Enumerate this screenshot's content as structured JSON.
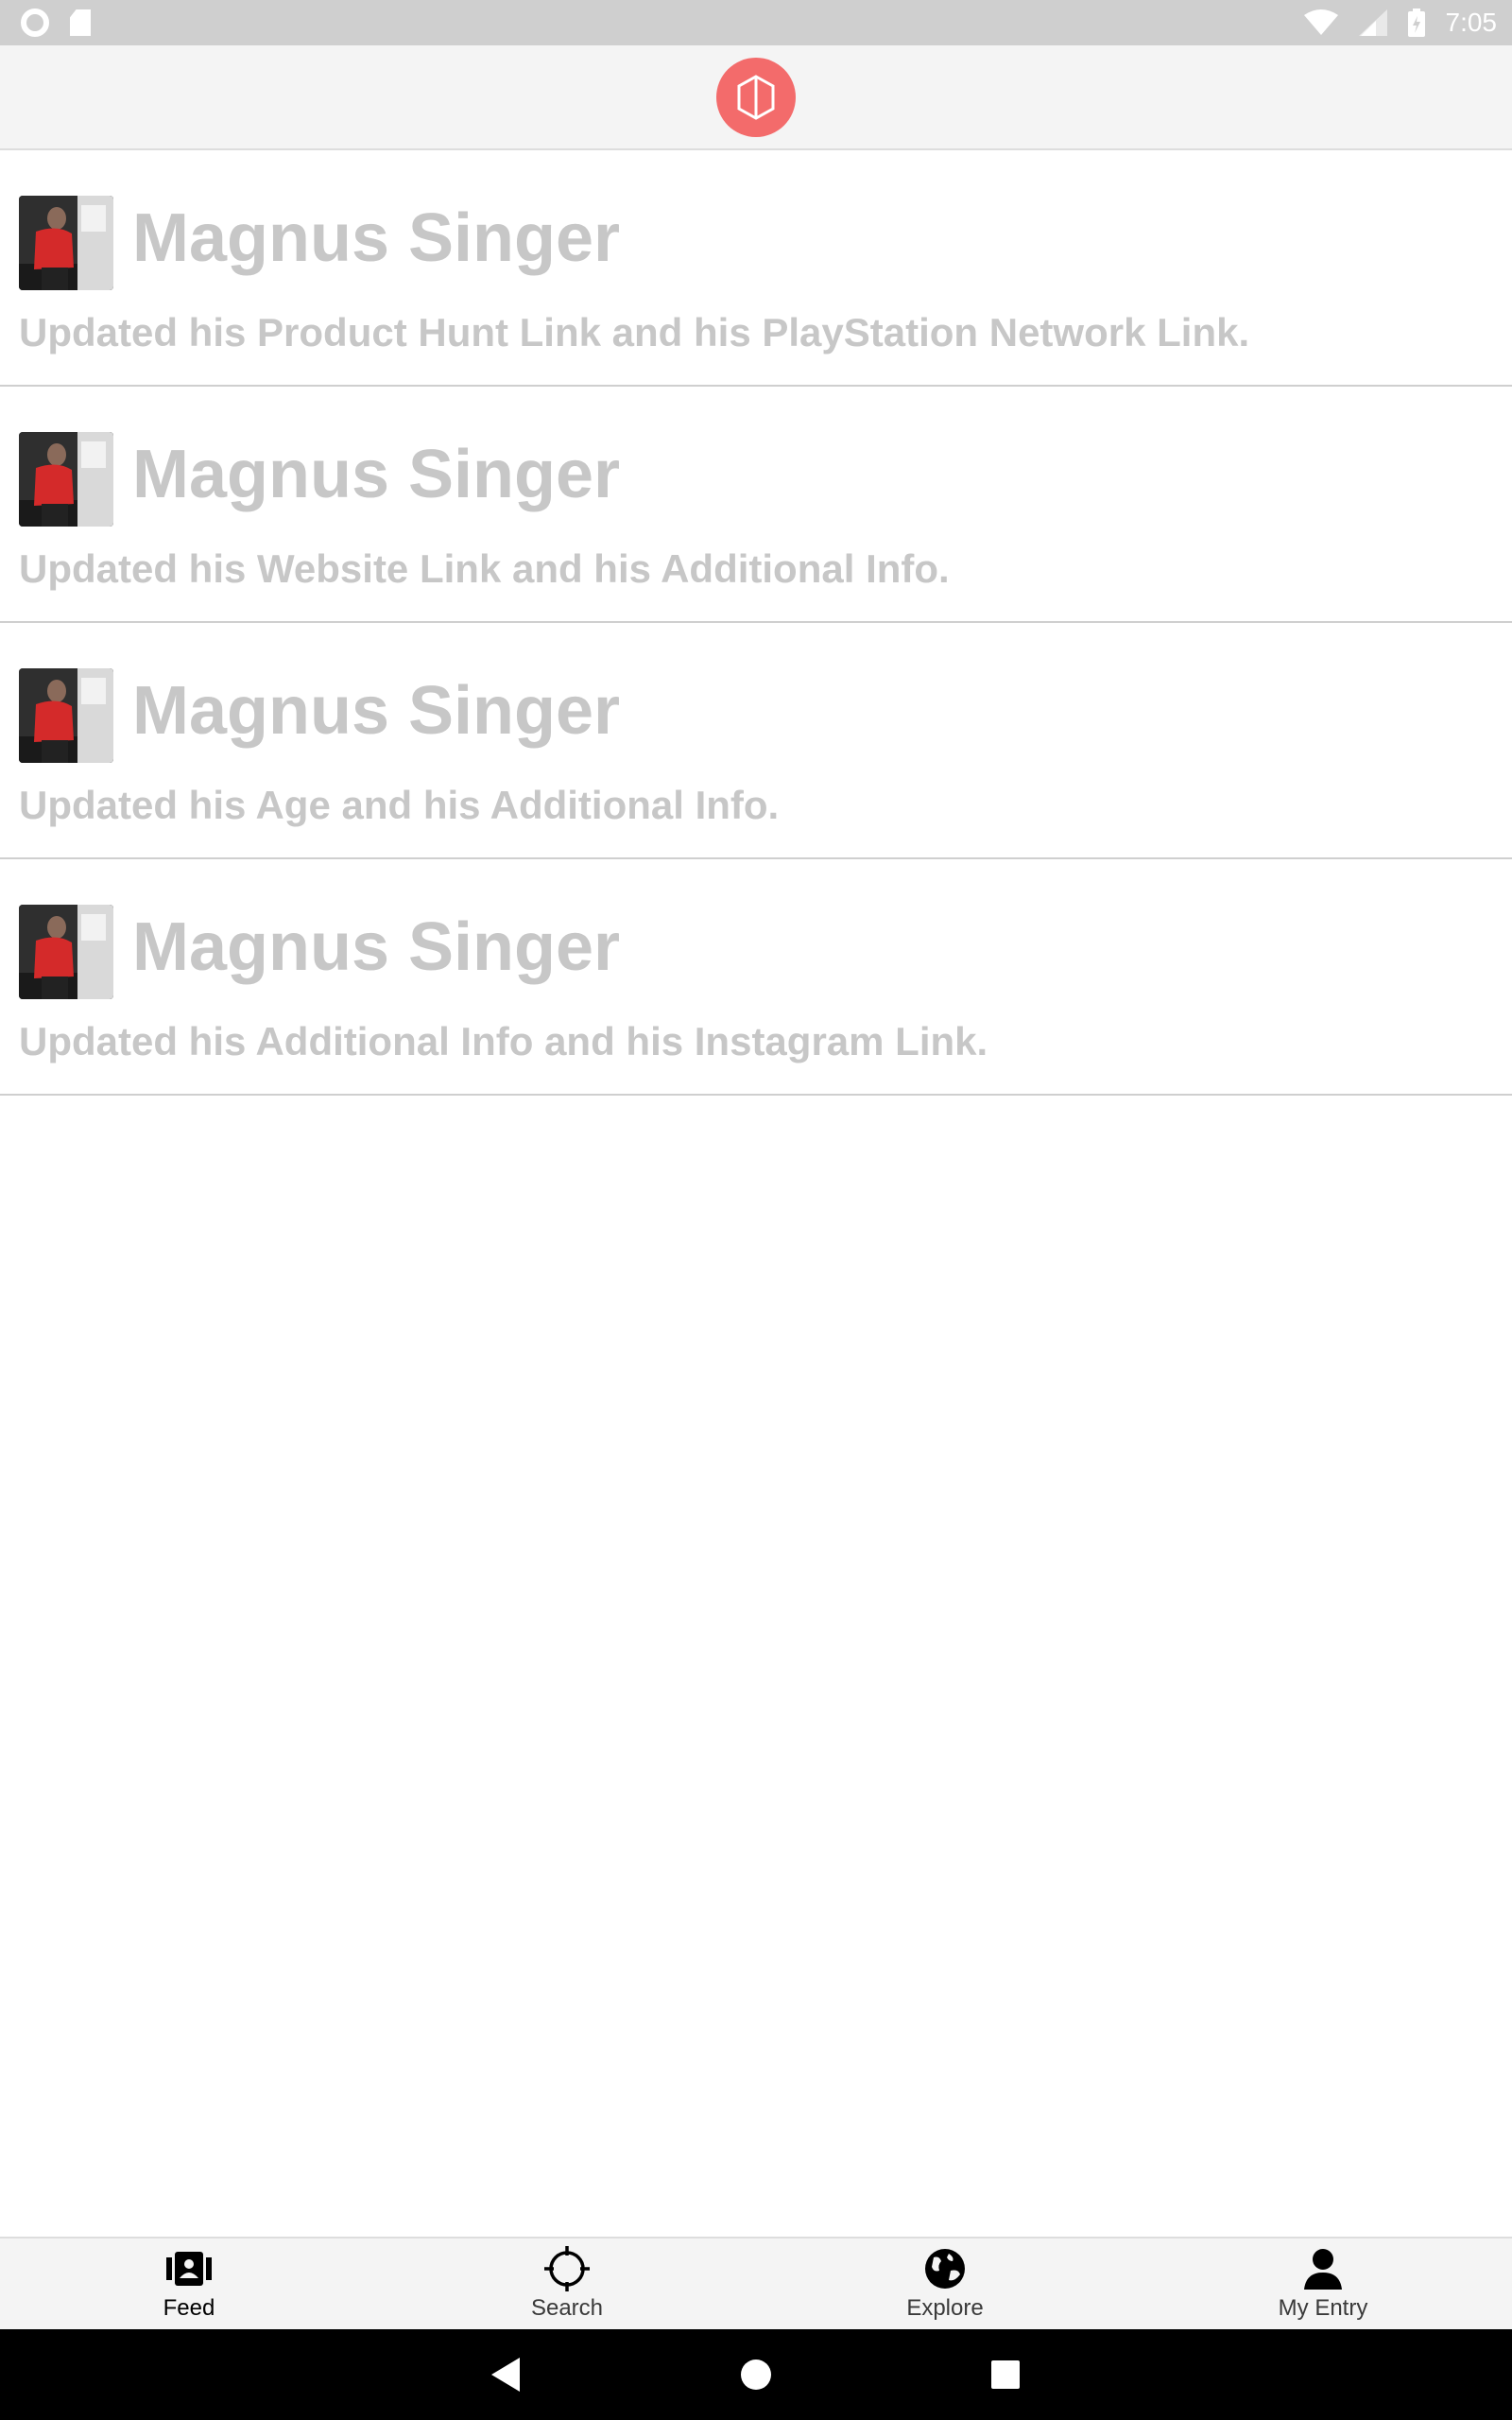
{
  "status_bar": {
    "time": "7:05",
    "icons": [
      "record-icon",
      "sd-card-icon",
      "wifi-icon",
      "signal-icon",
      "battery-icon"
    ]
  },
  "app_bar": {
    "logo_icon": "app-logo-icon",
    "logo_color": "#f36b6b"
  },
  "feed": {
    "items": [
      {
        "name": "Magnus Singer",
        "text": "Updated his Product Hunt Link and his PlayStation Network Link."
      },
      {
        "name": "Magnus Singer",
        "text": "Updated his Website Link and his Additional Info."
      },
      {
        "name": "Magnus Singer",
        "text": "Updated his Age and his Additional Info."
      },
      {
        "name": "Magnus Singer",
        "text": "Updated his Additional Info and his Instagram Link."
      }
    ]
  },
  "bottom_nav": {
    "items": [
      {
        "label": "Feed",
        "icon": "feed-icon",
        "active": true
      },
      {
        "label": "Search",
        "icon": "crosshair-icon",
        "active": false
      },
      {
        "label": "Explore",
        "icon": "globe-icon",
        "active": false
      },
      {
        "label": "My Entry",
        "icon": "person-icon",
        "active": false
      }
    ]
  },
  "system_nav": {
    "icons": [
      "back-icon",
      "home-icon",
      "recents-icon"
    ]
  }
}
